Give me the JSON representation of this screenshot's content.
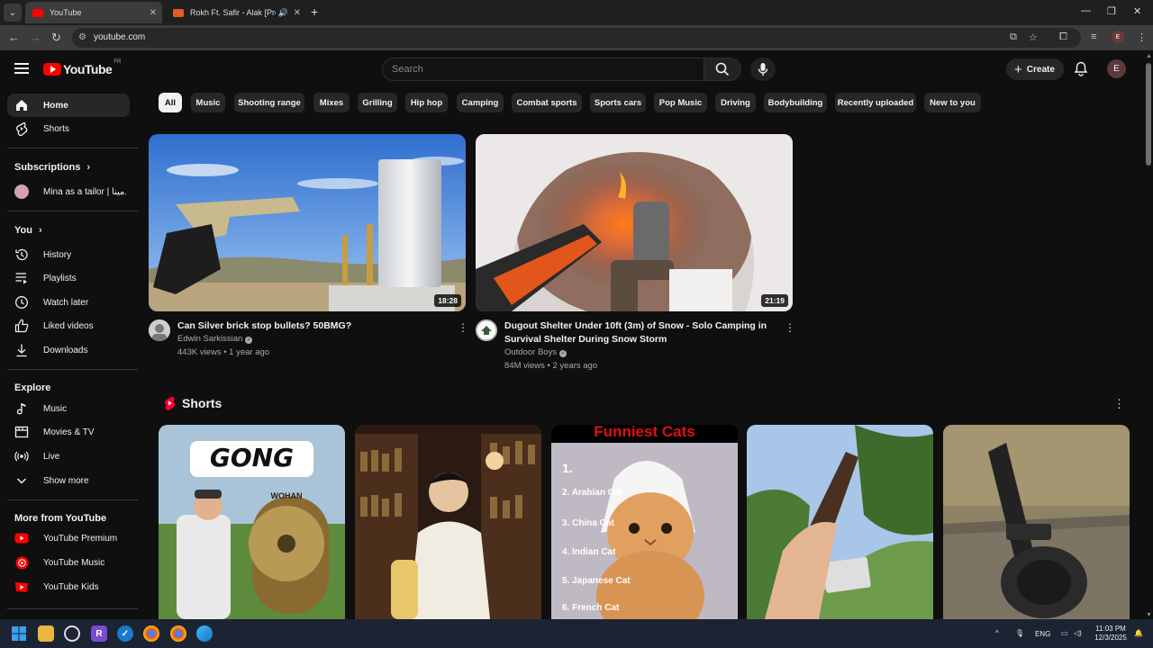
{
  "browser": {
    "tabs": [
      {
        "title": "YouTube",
        "active": true
      },
      {
        "title": "Rokh Ft. Safir - Alak [Prod. ...",
        "active": false
      }
    ],
    "url": "youtube.com",
    "profile_initial": "E"
  },
  "header": {
    "logo_text": "YouTube",
    "country_code": "FR",
    "search_placeholder": "Search",
    "create_label": "Create",
    "avatar_initial": "E"
  },
  "sidebar": {
    "main": [
      {
        "label": "Home",
        "icon": "home-icon",
        "active": true
      },
      {
        "label": "Shorts",
        "icon": "shorts-icon"
      }
    ],
    "subscriptions_heading": "Subscriptions",
    "subscriptions": [
      {
        "label": "Mina as a tailor | مينا..."
      }
    ],
    "you_heading": "You",
    "you": [
      {
        "label": "History",
        "icon": "history-icon"
      },
      {
        "label": "Playlists",
        "icon": "playlists-icon"
      },
      {
        "label": "Watch later",
        "icon": "watch-later-icon"
      },
      {
        "label": "Liked videos",
        "icon": "like-icon"
      },
      {
        "label": "Downloads",
        "icon": "download-icon"
      }
    ],
    "explore_heading": "Explore",
    "explore": [
      {
        "label": "Music",
        "icon": "music-icon"
      },
      {
        "label": "Movies & TV",
        "icon": "movies-icon"
      },
      {
        "label": "Live",
        "icon": "live-icon"
      },
      {
        "label": "Show more",
        "icon": "chevron-down-icon"
      }
    ],
    "more_heading": "More from YouTube",
    "more": [
      {
        "label": "YouTube Premium",
        "icon": "youtube-premium-icon"
      },
      {
        "label": "YouTube Music",
        "icon": "youtube-music-icon"
      },
      {
        "label": "YouTube Kids",
        "icon": "youtube-kids-icon"
      }
    ]
  },
  "chips": [
    "All",
    "Music",
    "Shooting range",
    "Mixes",
    "Grilling",
    "Hip hop",
    "Camping",
    "Combat sports",
    "Sports cars",
    "Pop Music",
    "Driving",
    "Bodybuilding",
    "Recently uploaded",
    "New to you"
  ],
  "videos": [
    {
      "title": "Can Silver brick stop bullets? 50BMG?",
      "channel": "Edwin Sarkissian",
      "meta": "443K views • 1 year ago",
      "duration": "18:28"
    },
    {
      "title": "Dugout Shelter Under 10ft (3m) of Snow - Solo Camping in Survival Shelter During Snow Storm",
      "channel": "Outdoor Boys",
      "meta": "84M views • 2 years ago",
      "duration": "21:19"
    }
  ],
  "shorts": {
    "heading": "Shorts",
    "thumb_texts": {
      "gong": "GONG",
      "gong_sign": "WOHAN",
      "cats_title": "Funniest Cats",
      "cats_list": [
        "1.",
        "2. Arabian Cat",
        "3. China Cat",
        "4. Indian Cat",
        "5. Japanese Cat",
        "6. French Cat"
      ]
    }
  },
  "taskbar": {
    "lang": "ENG",
    "time": "11:03 PM",
    "date": "12/3/2025"
  },
  "colors": {
    "brand_red": "#ff0000",
    "background": "#0f0f0f",
    "chip_bg": "#272727"
  }
}
